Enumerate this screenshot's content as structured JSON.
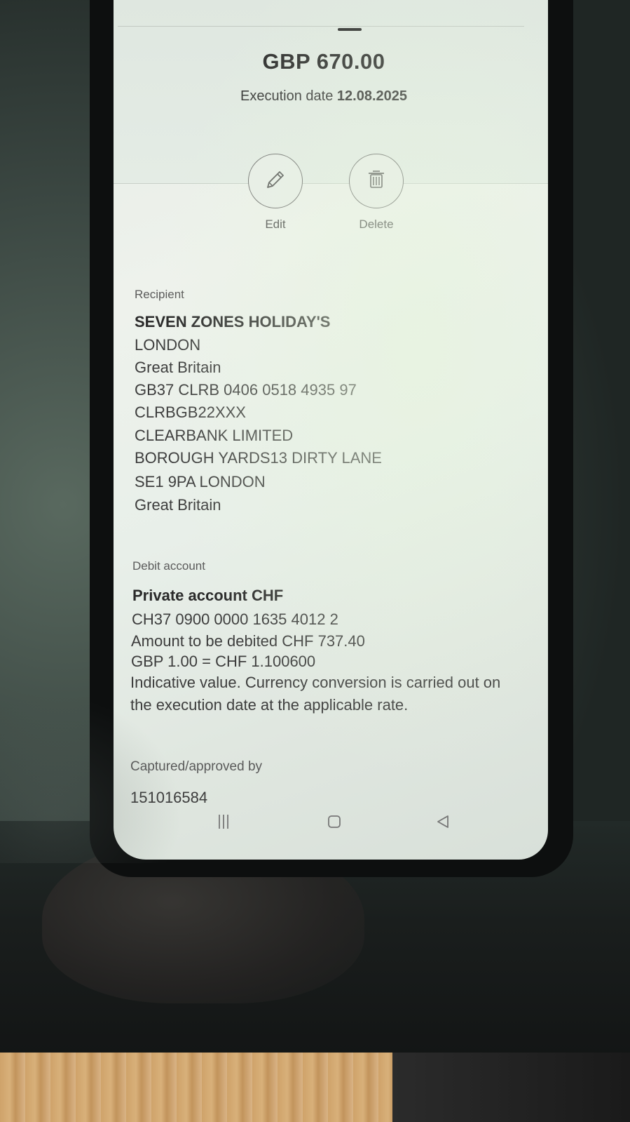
{
  "payment": {
    "amount": "GBP 670.00",
    "execution_label": "Execution date",
    "execution_date": "12.08.2025"
  },
  "actions": {
    "edit_label": "Edit",
    "delete_label": "Delete"
  },
  "recipient": {
    "section_label": "Recipient",
    "name": "SEVEN ZONES HOLIDAY'S",
    "lines": [
      "LONDON",
      "Great Britain",
      "GB37 CLRB 0406 0518 4935 97",
      "CLRBGB22XXX",
      "CLEARBANK LIMITED",
      "BOROUGH YARDS13 DIRTY LANE",
      "SE1 9PA LONDON",
      "Great Britain"
    ]
  },
  "debit": {
    "section_label": "Debit account",
    "account_name": "Private account CHF",
    "lines": [
      "CH37 0900 0000 1635 4012 2",
      "Amount to be debited CHF 737.40",
      "GBP 1.00 = CHF 1.100600",
      "Indicative value. Currency conversion is carried out on",
      "the execution date at the applicable rate."
    ]
  },
  "approval": {
    "section_label": "Captured/approved by",
    "value": "151016584"
  },
  "icons": {
    "edit": "pencil-icon",
    "delete": "trash-icon",
    "nav_menu": "recent-apps-icon",
    "nav_home": "home-icon",
    "nav_back": "back-icon"
  },
  "colors": {
    "screen_bg": "#e8efe9",
    "text": "#2b2b2b"
  }
}
